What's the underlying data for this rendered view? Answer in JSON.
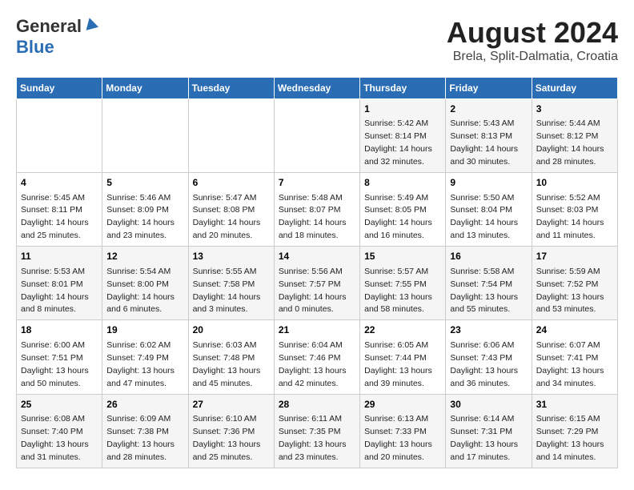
{
  "header": {
    "logo_general": "General",
    "logo_blue": "Blue",
    "title": "August 2024",
    "subtitle": "Brela, Split-Dalmatia, Croatia"
  },
  "days_of_week": [
    "Sunday",
    "Monday",
    "Tuesday",
    "Wednesday",
    "Thursday",
    "Friday",
    "Saturday"
  ],
  "weeks": [
    [
      {
        "day": "",
        "info": ""
      },
      {
        "day": "",
        "info": ""
      },
      {
        "day": "",
        "info": ""
      },
      {
        "day": "",
        "info": ""
      },
      {
        "day": "1",
        "info": "Sunrise: 5:42 AM\nSunset: 8:14 PM\nDaylight: 14 hours\nand 32 minutes."
      },
      {
        "day": "2",
        "info": "Sunrise: 5:43 AM\nSunset: 8:13 PM\nDaylight: 14 hours\nand 30 minutes."
      },
      {
        "day": "3",
        "info": "Sunrise: 5:44 AM\nSunset: 8:12 PM\nDaylight: 14 hours\nand 28 minutes."
      }
    ],
    [
      {
        "day": "4",
        "info": "Sunrise: 5:45 AM\nSunset: 8:11 PM\nDaylight: 14 hours\nand 25 minutes."
      },
      {
        "day": "5",
        "info": "Sunrise: 5:46 AM\nSunset: 8:09 PM\nDaylight: 14 hours\nand 23 minutes."
      },
      {
        "day": "6",
        "info": "Sunrise: 5:47 AM\nSunset: 8:08 PM\nDaylight: 14 hours\nand 20 minutes."
      },
      {
        "day": "7",
        "info": "Sunrise: 5:48 AM\nSunset: 8:07 PM\nDaylight: 14 hours\nand 18 minutes."
      },
      {
        "day": "8",
        "info": "Sunrise: 5:49 AM\nSunset: 8:05 PM\nDaylight: 14 hours\nand 16 minutes."
      },
      {
        "day": "9",
        "info": "Sunrise: 5:50 AM\nSunset: 8:04 PM\nDaylight: 14 hours\nand 13 minutes."
      },
      {
        "day": "10",
        "info": "Sunrise: 5:52 AM\nSunset: 8:03 PM\nDaylight: 14 hours\nand 11 minutes."
      }
    ],
    [
      {
        "day": "11",
        "info": "Sunrise: 5:53 AM\nSunset: 8:01 PM\nDaylight: 14 hours\nand 8 minutes."
      },
      {
        "day": "12",
        "info": "Sunrise: 5:54 AM\nSunset: 8:00 PM\nDaylight: 14 hours\nand 6 minutes."
      },
      {
        "day": "13",
        "info": "Sunrise: 5:55 AM\nSunset: 7:58 PM\nDaylight: 14 hours\nand 3 minutes."
      },
      {
        "day": "14",
        "info": "Sunrise: 5:56 AM\nSunset: 7:57 PM\nDaylight: 14 hours\nand 0 minutes."
      },
      {
        "day": "15",
        "info": "Sunrise: 5:57 AM\nSunset: 7:55 PM\nDaylight: 13 hours\nand 58 minutes."
      },
      {
        "day": "16",
        "info": "Sunrise: 5:58 AM\nSunset: 7:54 PM\nDaylight: 13 hours\nand 55 minutes."
      },
      {
        "day": "17",
        "info": "Sunrise: 5:59 AM\nSunset: 7:52 PM\nDaylight: 13 hours\nand 53 minutes."
      }
    ],
    [
      {
        "day": "18",
        "info": "Sunrise: 6:00 AM\nSunset: 7:51 PM\nDaylight: 13 hours\nand 50 minutes."
      },
      {
        "day": "19",
        "info": "Sunrise: 6:02 AM\nSunset: 7:49 PM\nDaylight: 13 hours\nand 47 minutes."
      },
      {
        "day": "20",
        "info": "Sunrise: 6:03 AM\nSunset: 7:48 PM\nDaylight: 13 hours\nand 45 minutes."
      },
      {
        "day": "21",
        "info": "Sunrise: 6:04 AM\nSunset: 7:46 PM\nDaylight: 13 hours\nand 42 minutes."
      },
      {
        "day": "22",
        "info": "Sunrise: 6:05 AM\nSunset: 7:44 PM\nDaylight: 13 hours\nand 39 minutes."
      },
      {
        "day": "23",
        "info": "Sunrise: 6:06 AM\nSunset: 7:43 PM\nDaylight: 13 hours\nand 36 minutes."
      },
      {
        "day": "24",
        "info": "Sunrise: 6:07 AM\nSunset: 7:41 PM\nDaylight: 13 hours\nand 34 minutes."
      }
    ],
    [
      {
        "day": "25",
        "info": "Sunrise: 6:08 AM\nSunset: 7:40 PM\nDaylight: 13 hours\nand 31 minutes."
      },
      {
        "day": "26",
        "info": "Sunrise: 6:09 AM\nSunset: 7:38 PM\nDaylight: 13 hours\nand 28 minutes."
      },
      {
        "day": "27",
        "info": "Sunrise: 6:10 AM\nSunset: 7:36 PM\nDaylight: 13 hours\nand 25 minutes."
      },
      {
        "day": "28",
        "info": "Sunrise: 6:11 AM\nSunset: 7:35 PM\nDaylight: 13 hours\nand 23 minutes."
      },
      {
        "day": "29",
        "info": "Sunrise: 6:13 AM\nSunset: 7:33 PM\nDaylight: 13 hours\nand 20 minutes."
      },
      {
        "day": "30",
        "info": "Sunrise: 6:14 AM\nSunset: 7:31 PM\nDaylight: 13 hours\nand 17 minutes."
      },
      {
        "day": "31",
        "info": "Sunrise: 6:15 AM\nSunset: 7:29 PM\nDaylight: 13 hours\nand 14 minutes."
      }
    ]
  ]
}
